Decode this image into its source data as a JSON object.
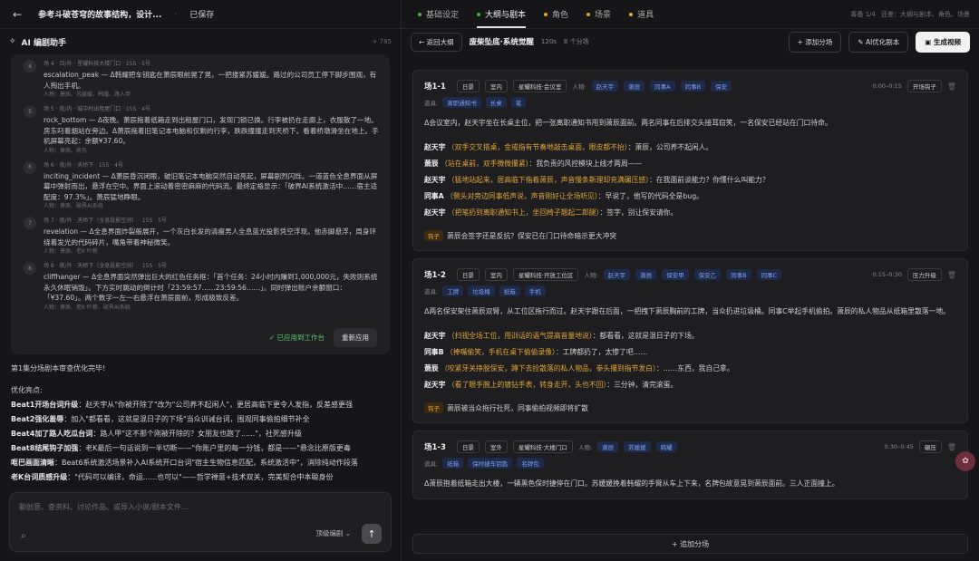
{
  "topbar": {
    "title": "参考斗破苍穹的故事结构，设计...",
    "sep": "·",
    "saved": "已保存",
    "tabs": [
      {
        "label": "基础设定",
        "dot": "#4caf50"
      },
      {
        "label": "大纲与剧本",
        "dot": "#4caf50"
      },
      {
        "label": "角色",
        "dot": "#e2a537"
      },
      {
        "label": "场景",
        "dot": "#e2a537"
      },
      {
        "label": "道具",
        "dot": "#e2a537"
      }
    ],
    "meta1": "筹备 1/4",
    "meta2": "还差：大纲与剧本、角色、场景"
  },
  "assistant": {
    "title": "AI 编剧助手",
    "count": "+ 785"
  },
  "beats": [
    {
      "num": "4",
      "meta": "场 4 · 日/外 · 星耀科技大楼门口 · 15S · 5号",
      "text": "escalation_peak — Δ韩耀把车钥匙在萧辰眼前晃了晃，一把搂紧苏媛媛。路过的公司员工停下脚步围观，有人掏出手机。",
      "chars": "人物：萧辰、苏媛媛、韩耀、路人甲"
    },
    {
      "num": "5",
      "meta": "场 5 · 夜/内 · 城中村出租屋门口 · 15S · 4号",
      "text": "rock_bottom — Δ夜晚。萧辰拖着纸箱走到出租屋门口，发现门锁已换。行李被扔在走廊上，衣服散了一地。房东叼着烟站在旁边。Δ萧辰拖着旧笔记本电脑和仅剩的行李，跌跌撞撞走到天桥下。看着桥墩滑坐在地上。手机屏幕亮起：余额¥37.60。",
      "chars": "人物：萧辰、房东"
    },
    {
      "num": "6",
      "meta": "场 6 · 夜/外 · 天桥下 · 15S · 4号",
      "text": "inciting_incident — Δ萧辰昏沉闭眼，破旧笔记本电脑突然自动亮起，屏幕剧烈闪烁。一道蓝色全息界面从屏幕中弹射而出，悬浮在空中。界面上滚动着密密麻麻的代码流。最终定格显示：「破界AI系统激活中……宿主适配度：97.3%」。萧辰猛地睁眼。",
      "chars": "人物：萧辰、破界AI系统"
    },
    {
      "num": "7",
      "meta": "场 7 · 夜/外 · 天桥下（全息投影空间） · 15S · 5号",
      "text": "revelation — Δ全息界面炸裂般展开，一个灰白长发的清瘦男人全息蓝光投影凭空浮现。他赤脚悬浮，周身环绕着发光的代码碎片，嘴角带着神秘微笑。",
      "chars": "人物：萧辰、老K·叶薪"
    },
    {
      "num": "8",
      "meta": "场 8 · 夜/外 · 天桥下（全息投影空间） · 15S · 5号",
      "text": "cliffhanger — Δ全息界面突然弹出巨大的红色任务框：「首个任务：24小时内赚到1,000,000元，失败则系统永久休眠销毁」。下方实时跳动的倒计时「23:59:57……23:59:56……」。同时弹出账户余额窗口：「¥37.60」。两个数字一左一右悬浮在萧辰面前，形成极致反差。",
      "chars": "人物：萧辰、老K·叶薪、破界AI系统"
    }
  ],
  "card_foot": {
    "applied": "✓ 已应用到工作台",
    "reapply": "重新应用"
  },
  "summary": {
    "heading": "第1集分场剧本审查优化完毕!",
    "sub": "优化亮点:",
    "items": [
      {
        "b": "Beat1开场台词升级",
        "t": "：赵天宇从\"你被开除了\"改为\"公司养不起闲人\"，更居高临下更令人发指，反差感更强"
      },
      {
        "b": "Beat2强化羞辱",
        "t": "：加入\"都看看，这就是混日子的下场\"当众训诫台词，围观同事偷拍细节补全"
      },
      {
        "b": "Beat4加了路人吃瓜台词",
        "t": "：路人甲\"这不那个刚被开除的？女朋友也跑了......\"，社死感升级"
      },
      {
        "b": "Beat8结尾钩子加强",
        "t": "：老K最后一句话说到一半切断——\"你账户里的每一分钱，都是——\"悬念比原版更毒"
      },
      {
        "b": "哐巴画面清晰",
        "t": "：Beat6系统激活场景补入AI系统开口台词\"宿主生物信息匹配，系统激活中\"，消除纯动作段落"
      },
      {
        "b": "老K台词质感升级",
        "t": "：\"代码可以编译，命运......也可以\"——哲学禅意+技术双关，完美契合中本聪身份"
      }
    ]
  },
  "input": {
    "placeholder": "聊创意、查资料、讨论作品、或导入小说/剧本文件...",
    "mode": "顶级编剧 ⌄"
  },
  "scene": {
    "back": "返回大纲",
    "name": "废柴坠底·系统觉醒",
    "dur": "120s",
    "count": "8 个分场",
    "add": "+ 添加分场",
    "ai": "AI优化剧本",
    "gen": "生成视频"
  },
  "shots": [
    {
      "id": "场1-1",
      "time": "日景",
      "place": "室内",
      "loc": "星耀科技·会议室",
      "chars_label": "人物:",
      "chars": [
        "赵天宇",
        "萧辰",
        "同事A",
        "同事B",
        "保安"
      ],
      "range": "0:00–0:15",
      "mode": "开场钩子",
      "props_label": "道具:",
      "props": [
        "离职通知书",
        "长桌",
        "笔"
      ],
      "desc": "Δ会议室内，赵天宇坐在长桌主位，把一张离职通知书甩到萧辰面前。两名同事在后排交头接耳窃笑，一名保安已经站在门口待命。",
      "lines": [
        {
          "sp": "赵天宇",
          "act": "（双手交叉搭桌，金戒指有节奏地敲击桌面，眼皮都不抬）",
          "t": "：萧辰，公司养不起闲人。"
        },
        {
          "sp": "萧辰",
          "act": "（站在桌前，双手微微攥紧）",
          "t": "：我负责的风控模块上线才两周——"
        },
        {
          "sp": "赵天宇",
          "act": "（猛地站起来，居高临下指着萧辰，声音慢条斯理却充满碾压感）",
          "t": "：在我面前谈能力？你懂什么叫能力？"
        },
        {
          "sp": "同事A",
          "act": "（侧头对旁边同事低声说，声音刚好让全场听见）",
          "t": "：早说了，他写的代码全是bug。"
        },
        {
          "sp": "赵天宇",
          "act": "（把笔扔到离职通知书上，坐回椅子翘起二郎腿）",
          "t": "：签字，别让保安请你。"
        }
      ],
      "hook": "萧辰会签字还是反抗？保安已在门口待命暗示更大冲突"
    },
    {
      "id": "场1-2",
      "time": "日景",
      "place": "室内",
      "loc": "星耀科技·开放工位区",
      "chars_label": "人物:",
      "chars": [
        "赵天宇",
        "萧辰",
        "保安甲",
        "保安乙",
        "同事B",
        "同事C"
      ],
      "range": "0:15–0:30",
      "mode": "压力升级",
      "props_label": "道具:",
      "props": [
        "工牌",
        "垃圾桶",
        "纸箱",
        "手机"
      ],
      "desc": "Δ两名保安架住萧辰双臂，从工位区拖行而过。赵天宇跟在后面，一把拽下萧辰胸前的工牌，当众扔进垃圾桶。同事C举起手机偷拍。萧辰的私人物品从纸箱里散落一地。",
      "lines": [
        {
          "sp": "赵天宇",
          "act": "（扫视全场工位，用训话的语气提高音量地说）",
          "t": "：都看看，这就是混日子的下场。"
        },
        {
          "sp": "同事B",
          "act": "（捧嘴偷笑，手机在桌下偷偷录像）",
          "t": "：工牌都扔了，太惨了吧……"
        },
        {
          "sp": "萧辰",
          "act": "（咬紧牙关挣脱保安，蹲下去捡散落的私人物品，拳头攥到指节发白）",
          "t": "：……东西，我自己拿。"
        },
        {
          "sp": "赵天宇",
          "act": "（看了眼手腕上的镀钻手表，转身走开，头也不回）",
          "t": "：三分钟，清完滚蛋。"
        }
      ],
      "hook": "萧辰被当众拖行社死，同事偷拍视频即将扩散"
    },
    {
      "id": "场1-3",
      "time": "日景",
      "place": "室外",
      "loc": "星耀科技·大楼门口",
      "chars_label": "人物:",
      "chars": [
        "萧辰",
        "苏媛媛",
        "韩耀"
      ],
      "range": "0:30–0:45",
      "mode": "碾压",
      "props_label": "道具:",
      "props": [
        "纸箱",
        "保时捷车钥匙",
        "名牌包"
      ],
      "desc": "Δ萧辰抱着纸箱走出大楼，一辆黑色保时捷停在门口。苏媛媛挽着韩耀的手臂从车上下来，名牌包故意晃到萧辰面前。三人正面撞上。",
      "lines": [],
      "hook": ""
    }
  ],
  "add_shot": "+ 追加分场"
}
